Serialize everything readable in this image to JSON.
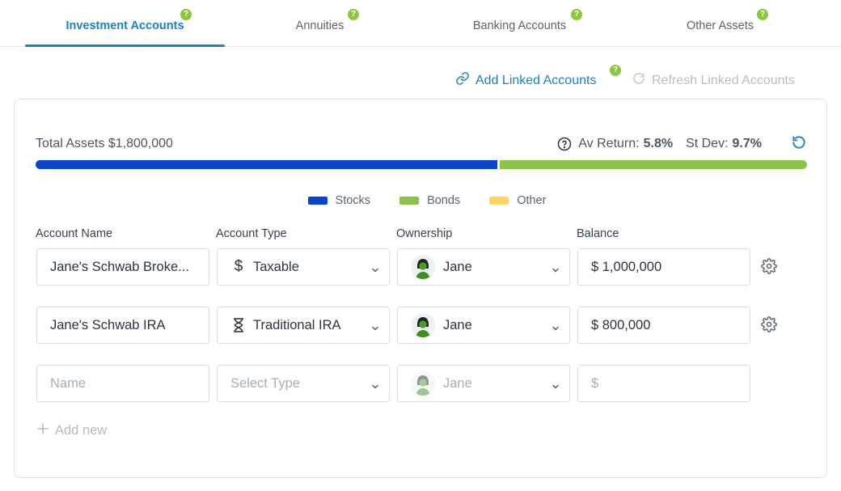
{
  "tabs": [
    {
      "label": "Investment Accounts",
      "active": true,
      "help": "?"
    },
    {
      "label": "Annuities",
      "active": false,
      "help": "?"
    },
    {
      "label": "Banking Accounts",
      "active": false,
      "help": "?"
    },
    {
      "label": "Other Assets",
      "active": false,
      "help": "?"
    }
  ],
  "actions": {
    "add_linked_label": "Add Linked Accounts",
    "add_linked_help": "?",
    "refresh_linked_label": "Refresh Linked Accounts"
  },
  "summary": {
    "total_label": "Total Assets $1,800,000",
    "av_return_label": "Av Return:",
    "av_return_value": "5.8%",
    "st_dev_label": "St Dev:",
    "st_dev_value": "9.7%"
  },
  "allocation": {
    "stocks_fraction": 0.6,
    "bonds_fraction": 0.4,
    "other_fraction": 0.0
  },
  "legend": [
    {
      "label": "Stocks",
      "color": "#0a45c9"
    },
    {
      "label": "Bonds",
      "color": "#8bc34a"
    },
    {
      "label": "Other",
      "color": "#fcd66b"
    }
  ],
  "columns": {
    "name": "Account Name",
    "type": "Account Type",
    "ownership": "Ownership",
    "balance": "Balance"
  },
  "accounts": [
    {
      "name": "Jane's Schwab Broke...",
      "type": "Taxable",
      "type_icon": "dollar-icon",
      "owner": "Jane",
      "balance": "$ 1,000,000"
    },
    {
      "name": "Jane's Schwab IRA",
      "type": "Traditional IRA",
      "type_icon": "hourglass-icon",
      "owner": "Jane",
      "balance": "$ 800,000"
    }
  ],
  "new_row": {
    "name_placeholder": "Name",
    "type_placeholder": "Select Type",
    "owner": "Jane",
    "balance_placeholder": "$"
  },
  "add_new_label": "Add new",
  "colors": {
    "accent": "#1d7fc4",
    "help_badge": "#8cc63f",
    "stocks": "#0a45c9",
    "bonds": "#8bc34a",
    "other": "#fcd66b"
  }
}
